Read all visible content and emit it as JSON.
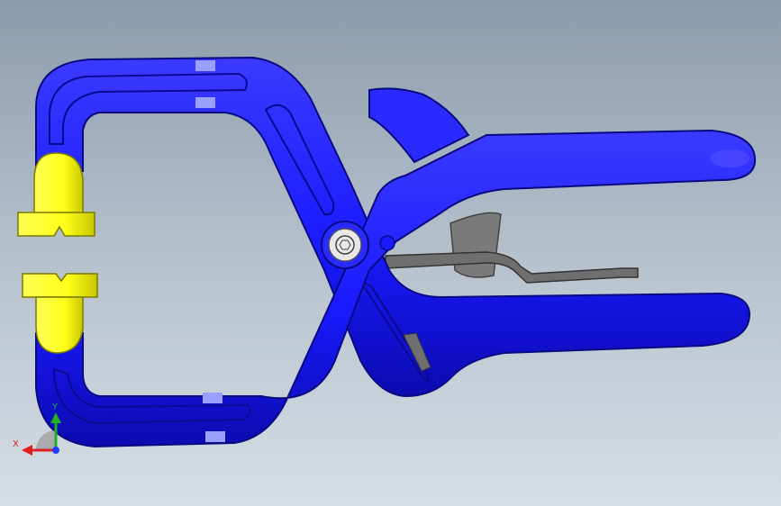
{
  "viewport": {
    "background_top": "#8c9bac",
    "background_bottom": "#d6dde4"
  },
  "model": {
    "body_color": "#1a1aff",
    "body_shadow": "#0d0db3",
    "pad_color": "#ffff1a",
    "pad_shadow": "#c9c900",
    "spring_color": "#6f6f6f",
    "marker_color": "#9aa0ff"
  },
  "triad": {
    "x_label": "X",
    "y_label": "Y",
    "x_color": "#e02020",
    "y_color": "#20b020",
    "z_color": "#2040ff"
  }
}
